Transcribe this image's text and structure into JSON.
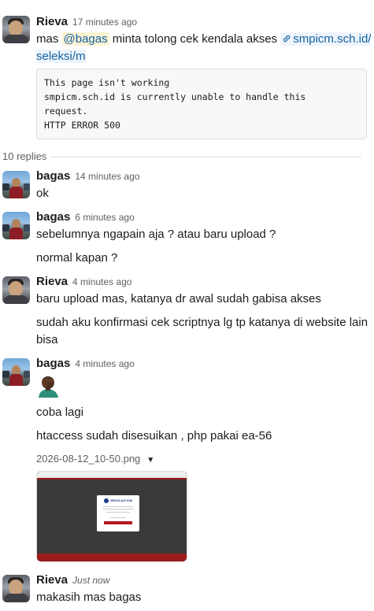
{
  "thread": {
    "parent": {
      "author": "Rieva",
      "time": "17 minutes ago",
      "text_prefix": "mas",
      "mention": "@bagas",
      "text_middle": "minta tolong cek kendala akses",
      "link_text_line1": "smpicm.sch.id/",
      "link_text_line2": "seleksi/m",
      "code_lines": [
        "This page isn't working",
        "smpicm.sch.id is currently unable to handle this",
        "request.",
        "HTTP ERROR 500"
      ]
    },
    "replies_label": "10 replies",
    "replies": [
      {
        "author": "bagas",
        "time": "14 minutes ago",
        "lines": [
          "ok"
        ]
      },
      {
        "author": "bagas",
        "time": "6 minutes ago",
        "lines": [
          "sebelumnya ngapain aja ? atau baru upload ?",
          "normal kapan ?"
        ]
      },
      {
        "author": "Rieva",
        "time": "4 minutes ago",
        "lines": [
          "baru upload mas, katanya dr awal sudah gabisa akses",
          "sudah aku konfirmasi cek scriptnya lg tp katanya di website lain",
          "bisa"
        ]
      },
      {
        "author": "bagas",
        "time": "4 minutes ago",
        "lines": [
          "coba lagi",
          "htaccess sudah disesuikan , php pakai ea-56"
        ],
        "emoji": "person-facepalming-emoji",
        "attachment": {
          "filename": "2026-08-12_10-50.png",
          "logo_text": "SEKOLAH ICM"
        }
      },
      {
        "author": "Rieva",
        "time": "Just now",
        "lines": [
          "makasih mas bagas"
        ]
      }
    ]
  },
  "icons": {
    "link": "link-icon",
    "caret": "caret-down-icon"
  }
}
